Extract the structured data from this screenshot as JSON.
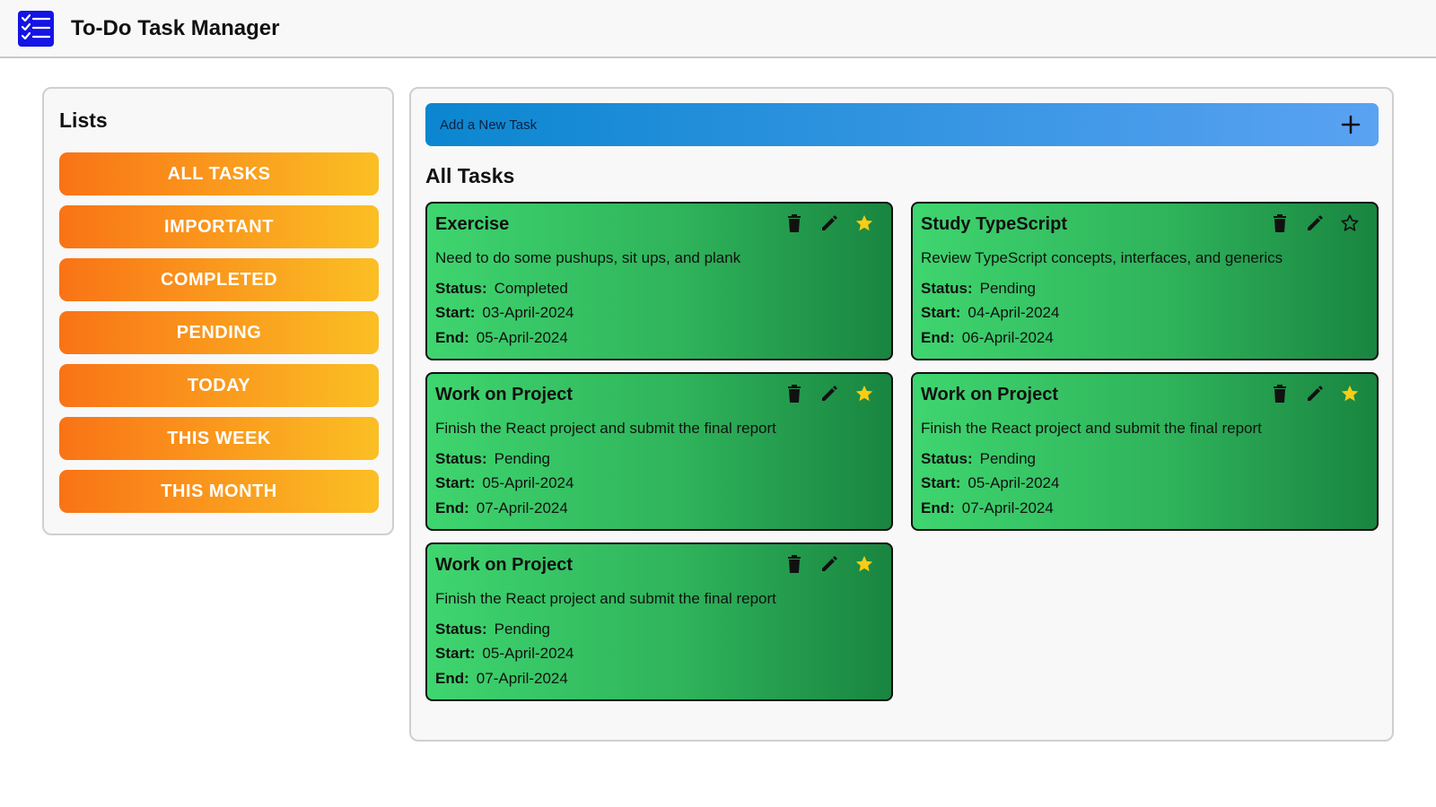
{
  "header": {
    "title": "To-Do Task Manager"
  },
  "sidebar": {
    "title": "Lists",
    "items": [
      {
        "label": "ALL TASKS"
      },
      {
        "label": "IMPORTANT"
      },
      {
        "label": "COMPLETED"
      },
      {
        "label": "PENDING"
      },
      {
        "label": "TODAY"
      },
      {
        "label": "THIS WEEK"
      },
      {
        "label": "THIS MONTH"
      }
    ]
  },
  "main": {
    "add_placeholder": "Add a New Task",
    "section_title": "All Tasks",
    "labels": {
      "status": "Status:",
      "start": "Start:",
      "end": "End:"
    },
    "tasks": [
      {
        "title": "Exercise",
        "description": "Need to do some pushups, sit ups, and plank",
        "status": "Completed",
        "start": "03-April-2024",
        "end": "05-April-2024",
        "important": true
      },
      {
        "title": "Study TypeScript",
        "description": "Review TypeScript concepts, interfaces, and generics",
        "status": "Pending",
        "start": "04-April-2024",
        "end": "06-April-2024",
        "important": false
      },
      {
        "title": "Work on Project",
        "description": "Finish the React project and submit the final report",
        "status": "Pending",
        "start": "05-April-2024",
        "end": "07-April-2024",
        "important": true
      },
      {
        "title": "Work on Project",
        "description": "Finish the React project and submit the final report",
        "status": "Pending",
        "start": "05-April-2024",
        "end": "07-April-2024",
        "important": true
      },
      {
        "title": "Work on Project",
        "description": "Finish the React project and submit the final report",
        "status": "Pending",
        "start": "05-April-2024",
        "end": "07-April-2024",
        "important": true
      }
    ]
  },
  "colors": {
    "logo": "#1414e6",
    "list_button_start": "#f97316",
    "list_button_end": "#fbbf24",
    "add_bar_start": "#0b86d0",
    "add_bar_end": "#5aa2f2",
    "card_start": "#3fd56f",
    "card_end": "#198540",
    "star_filled": "#facc15"
  }
}
